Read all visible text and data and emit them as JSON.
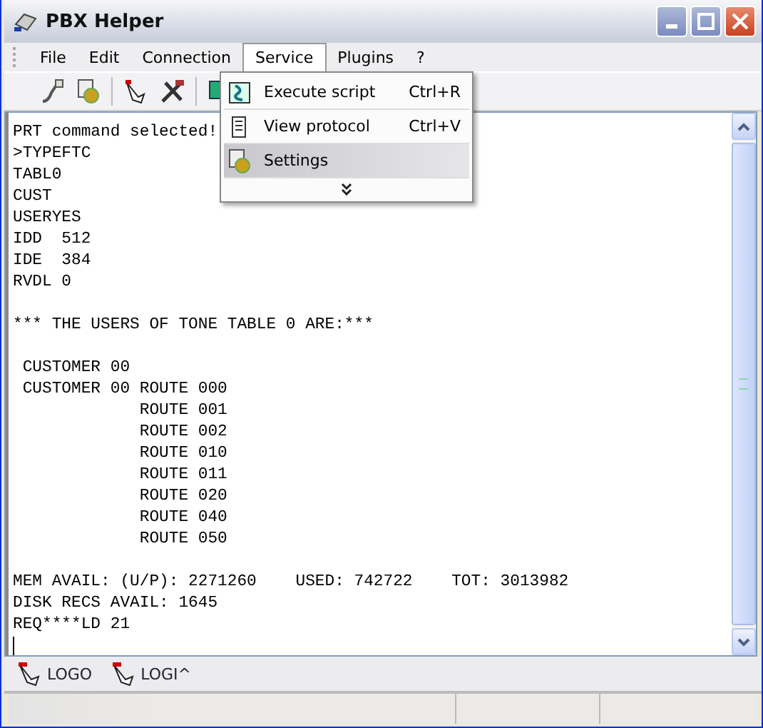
{
  "window": {
    "title": "PBX Helper"
  },
  "menu": [
    {
      "label": "File",
      "selected": false
    },
    {
      "label": "Edit",
      "selected": false
    },
    {
      "label": "Connection",
      "selected": false
    },
    {
      "label": "Service",
      "selected": true
    },
    {
      "label": "Plugins",
      "selected": false
    },
    {
      "label": "?",
      "selected": false
    }
  ],
  "service_menu": [
    {
      "label": "Execute script",
      "shortcut": "Ctrl+R",
      "selected": false,
      "kind": "script"
    },
    {
      "label": "View protocol",
      "shortcut": "Ctrl+V",
      "selected": false,
      "kind": "protocol"
    },
    {
      "label": "Settings",
      "selected": true,
      "kind": "settings"
    }
  ],
  "terminal_paragraphs": [
    [
      "PRT command selected!",
      ">TYPEFTC",
      "TABL0",
      "CUST",
      "USERYES",
      "IDD  512",
      "IDE  384",
      "RVDL 0"
    ],
    [
      "*** THE USERS OF TONE TABLE 0 ARE:***"
    ],
    [
      " CUSTOMER 00",
      " CUSTOMER 00 ROUTE 000",
      "             ROUTE 001",
      "             ROUTE 002",
      "             ROUTE 010",
      "             ROUTE 011",
      "             ROUTE 020",
      "             ROUTE 040",
      "             ROUTE 050"
    ],
    [
      "MEM AVAIL: (U/P): 2271260    USED: 742722    TOT: 3013982",
      "DISK RECS AVAIL: 1645",
      "REQ****LD 21"
    ]
  ],
  "quick_buttons": [
    {
      "label": "LOGO"
    },
    {
      "label": "LOGI^"
    }
  ]
}
